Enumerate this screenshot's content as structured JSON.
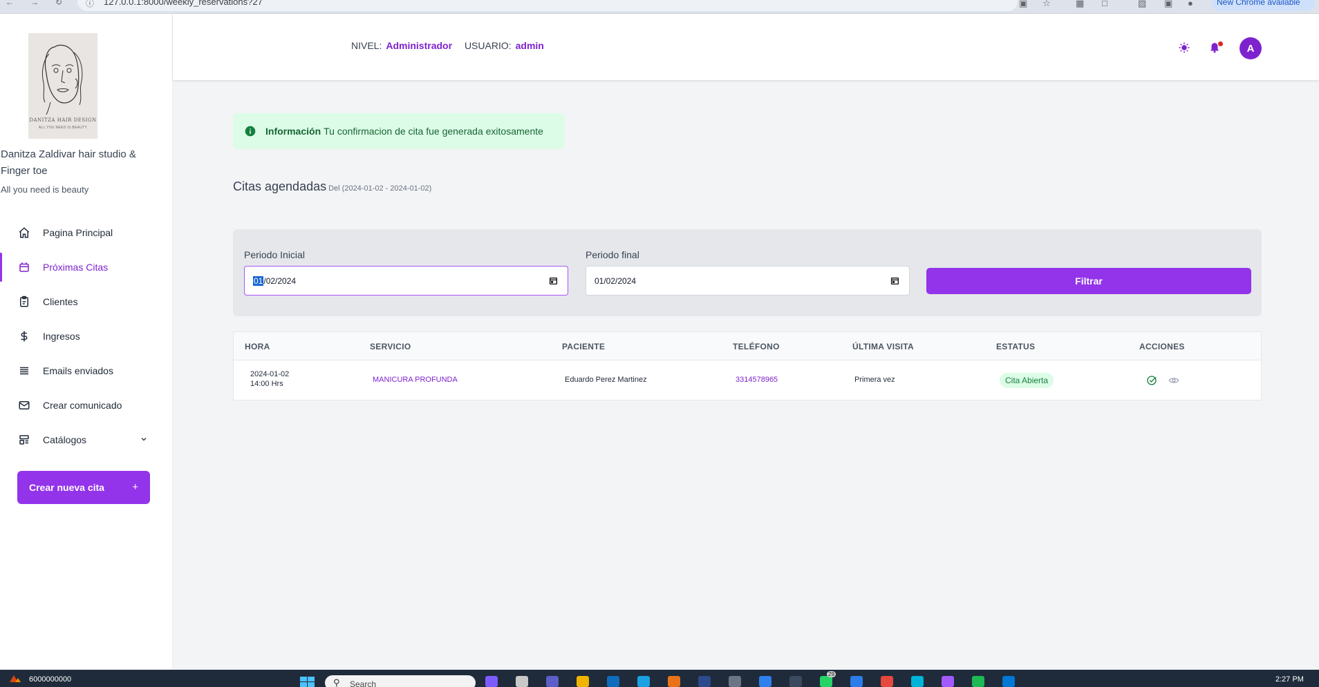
{
  "browser": {
    "url": "127.0.0.1:8000/weekly_reservations?27",
    "update_label": "New Chrome available"
  },
  "sidebar": {
    "logo": {
      "line1": "DANITZA HAIR DESIGN",
      "line2": "ALL YOU NEED IS BEAUTY"
    },
    "brand_name": "Danitza Zaldivar hair studio & Finger toe",
    "tagline": "All you need is beauty",
    "items": [
      {
        "label": "Pagina Principal",
        "icon": "home-icon",
        "active": false
      },
      {
        "label": "Próximas Citas",
        "icon": "calendar-icon",
        "active": true
      },
      {
        "label": "Clientes",
        "icon": "clipboard-icon",
        "active": false
      },
      {
        "label": "Ingresos",
        "icon": "dollar-icon",
        "active": false
      },
      {
        "label": "Emails enviados",
        "icon": "list-icon",
        "active": false
      },
      {
        "label": "Crear comunicado",
        "icon": "mail-icon",
        "active": false
      },
      {
        "label": "Catálogos",
        "icon": "catalog-icon",
        "active": false
      }
    ],
    "new_appointment_label": "Crear nueva cita",
    "new_appointment_plus": "+"
  },
  "header": {
    "level_label": "NIVEL:",
    "level_value": "Administrador",
    "user_label": "USUARIO:",
    "user_value": "admin",
    "avatar_initial": "A",
    "icons": [
      "sun-icon",
      "bell-icon"
    ]
  },
  "alert": {
    "title": "Información",
    "message": "Tu confirmacion de cita fue generada exitosamente"
  },
  "section": {
    "title": "Citas agendadas",
    "subtitle": "Del (2024-01-02 - 2024-01-02)"
  },
  "filter": {
    "start_label": "Periodo Inicial",
    "start_value_selected": "01",
    "start_value_rest": "/02/2024",
    "end_label": "Periodo final",
    "end_value": "01/02/2024",
    "button_label": "Filtrar"
  },
  "table": {
    "columns": [
      "HORA",
      "SERVICIO",
      "PACIENTE",
      "TELÉFONO",
      "ÚLTIMA VISITA",
      "ESTATUS",
      "ACCIONES"
    ],
    "rows": [
      {
        "date": "2024-01-02",
        "time": "14:00 Hrs",
        "service": "MANICURA PROFUNDA",
        "patient": "Eduardo Perez Martinez",
        "phone": "3314578965",
        "last_visit": "Primera vez",
        "status": "Cita Abierta"
      }
    ]
  },
  "taskbar": {
    "left_text": "6000000000",
    "search_placeholder": "Search",
    "clock": "2:27 PM",
    "badge": "29"
  },
  "colors": {
    "accent": "#9333ea",
    "accent_text": "#7e22ce",
    "success_bg": "#dcfce7",
    "success_text": "#166534"
  }
}
